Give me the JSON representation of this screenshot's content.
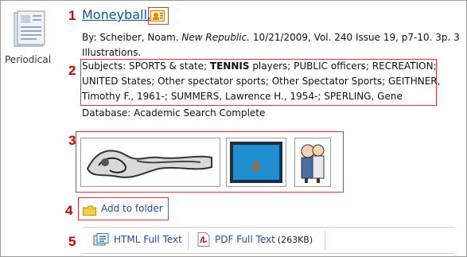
{
  "record": {
    "type_label": "Periodical",
    "title": "Moneyball.",
    "byline_line1": "By: Scheiber, Noam. New Republic. 10/21/2009, Vol. 240 Issue 19, p7-10. 3p. 3",
    "byline_prefix": "By: Scheiber, Noam. ",
    "journal": "New Republic.",
    "byline_suffix": " 10/21/2009, Vol. 240 Issue 19, p7-10. 3p. 3",
    "byline_line2": "Illustrations.",
    "subjects_lines": [
      "Subjects: SPORTS & state; ",
      "UNITED States; Other spectator sports; Other Spectator Sports; GEITHNER,",
      "Timothy F., 1961-; SUMMERS, Lawrence H., 1954-; SPERLING, Gene"
    ],
    "subjects_bold": "TENNIS",
    "subjects_line1_rest": " players; PUBLIC officers; RECREATION;",
    "database": "Database: Academic Search Complete"
  },
  "annotations": [
    "1",
    "2",
    "3",
    "4",
    "5"
  ],
  "actions": {
    "add_to_folder": "Add to folder"
  },
  "fulltext": {
    "html_label": "HTML Full Text",
    "pdf_label": "PDF Full Text",
    "pdf_size": "(263KB)"
  },
  "icons": {
    "periodical": "periodical-icon",
    "title_badge": "image-badge-icon",
    "folder": "folder-icon",
    "html": "html-fulltext-icon",
    "pdf": "pdf-icon"
  },
  "colors": {
    "annotation": "#cc0000",
    "link": "#1a4f9c"
  }
}
